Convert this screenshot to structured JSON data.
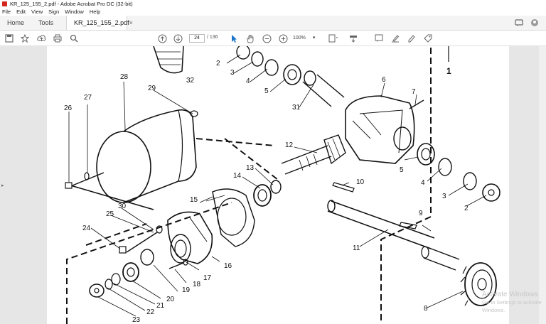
{
  "window": {
    "title": "KR_125_155_2.pdf - Adobe Acrobat Pro DC (32-bit)"
  },
  "menu": [
    "File",
    "Edit",
    "View",
    "Sign",
    "Window",
    "Help"
  ],
  "tabs": {
    "home": "Home",
    "tools": "Tools",
    "document": "KR_125_155_2.pdf",
    "close": "×"
  },
  "toolbar": {
    "page_current": "24",
    "page_total": "/ 136",
    "zoom": "100%"
  },
  "diagram": {
    "labels": [
      "1",
      "2",
      "3",
      "4",
      "5",
      "31",
      "6",
      "7",
      "28",
      "29",
      "32",
      "27",
      "26",
      "12",
      "13",
      "14",
      "15",
      "10",
      "5",
      "4",
      "3",
      "2",
      "9",
      "30",
      "25",
      "24",
      "11",
      "16",
      "17",
      "18",
      "19",
      "20",
      "21",
      "22",
      "23",
      "8",
      "2",
      "3",
      "4",
      "5"
    ]
  },
  "watermark": {
    "line1": "Activate Windows",
    "line2": "Go to Settings to activate Windows."
  }
}
